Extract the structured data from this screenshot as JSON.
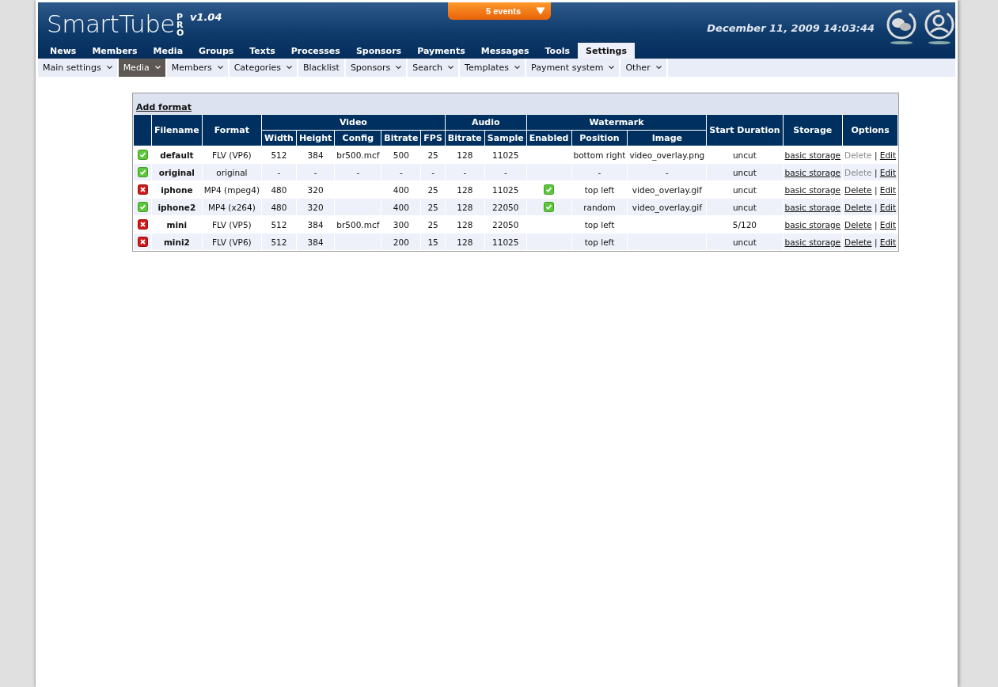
{
  "header": {
    "logo": "SmartTube",
    "logo_badge": "PRO",
    "version": "v1.04",
    "events": "5 events",
    "datetime": "December 11, 2009 14:03:44"
  },
  "nav": [
    {
      "label": "News",
      "selected": false
    },
    {
      "label": "Members",
      "selected": false
    },
    {
      "label": "Media",
      "selected": false
    },
    {
      "label": "Groups",
      "selected": false
    },
    {
      "label": "Texts",
      "selected": false
    },
    {
      "label": "Processes",
      "selected": false
    },
    {
      "label": "Sponsors",
      "selected": false
    },
    {
      "label": "Payments",
      "selected": false
    },
    {
      "label": "Messages",
      "selected": false
    },
    {
      "label": "Tools",
      "selected": false
    },
    {
      "label": "Settings",
      "selected": true
    }
  ],
  "subnav": [
    {
      "label": "Main settings",
      "kind": "dropdown",
      "selected": false
    },
    {
      "label": "Media",
      "kind": "dropdown",
      "selected": true
    },
    {
      "label": "Members",
      "kind": "dropdown",
      "selected": false
    },
    {
      "label": "Categories",
      "kind": "dropdown",
      "selected": false
    },
    {
      "label": "Blacklist",
      "kind": "link",
      "selected": false
    },
    {
      "label": "Sponsors",
      "kind": "dropdown",
      "selected": false
    },
    {
      "label": "Search",
      "kind": "dropdown",
      "selected": false
    },
    {
      "label": "Templates",
      "kind": "dropdown",
      "selected": false
    },
    {
      "label": "Payment system",
      "kind": "dropdown",
      "selected": false
    },
    {
      "label": "Other",
      "kind": "dropdown",
      "selected": false
    }
  ],
  "table": {
    "action": "Add format",
    "groups": [
      {
        "label": "Video",
        "columns": [
          "Width",
          "Height",
          "Config",
          "Bitrate",
          "FPS"
        ]
      },
      {
        "label": "Audio",
        "columns": [
          "Bitrate",
          "Sample"
        ]
      },
      {
        "label": "Watermark",
        "columns": [
          "Enabled",
          "Position",
          "Image"
        ]
      }
    ],
    "columns_before": [
      "Filename",
      "Format"
    ],
    "columns_after": [
      "Start Duration",
      "Storage",
      "Options"
    ],
    "rows": [
      {
        "active": true,
        "filename": "default",
        "format": "FLV (VP6)",
        "cells": [
          "512",
          "384",
          "br500.mcf",
          "500",
          "25",
          "128",
          "11025"
        ],
        "watermark_enabled": false,
        "position": "bottom right",
        "image": "video_overlay.png",
        "start_duration": "uncut",
        "storage": "basic storage",
        "delete": "Delete",
        "delete_disabled": true,
        "separator": "|",
        "edit": "Edit"
      },
      {
        "active": true,
        "filename": "original",
        "format": "original",
        "cells": [
          "-",
          "-",
          "-",
          "-",
          "-",
          "-",
          "-"
        ],
        "watermark_enabled": false,
        "position": "-",
        "image": "-",
        "start_duration": "uncut",
        "storage": "basic storage",
        "delete": "Delete",
        "delete_disabled": true,
        "separator": "|",
        "edit": "Edit"
      },
      {
        "active": false,
        "filename": "iphone",
        "format": "MP4 (mpeg4)",
        "cells": [
          "480",
          "320",
          "",
          "400",
          "25",
          "128",
          "11025"
        ],
        "watermark_enabled": true,
        "position": "top left",
        "image": "video_overlay.gif",
        "start_duration": "uncut",
        "storage": "basic storage",
        "delete": "Delete",
        "delete_disabled": false,
        "separator": "|",
        "edit": "Edit"
      },
      {
        "active": true,
        "filename": "iphone2",
        "format": "MP4 (x264)",
        "cells": [
          "480",
          "320",
          "",
          "400",
          "25",
          "128",
          "22050"
        ],
        "watermark_enabled": true,
        "position": "random",
        "image": "video_overlay.gif",
        "start_duration": "uncut",
        "storage": "basic storage",
        "delete": "Delete",
        "delete_disabled": false,
        "separator": "|",
        "edit": "Edit"
      },
      {
        "active": false,
        "filename": "mini",
        "format": "FLV (VP5)",
        "cells": [
          "512",
          "384",
          "br500.mcf",
          "300",
          "25",
          "128",
          "22050"
        ],
        "watermark_enabled": false,
        "position": "top left",
        "image": "",
        "start_duration": "5/120",
        "storage": "basic storage",
        "delete": "Delete",
        "delete_disabled": false,
        "separator": "|",
        "edit": "Edit"
      },
      {
        "active": false,
        "filename": "mini2",
        "format": "FLV (VP6)",
        "cells": [
          "512",
          "384",
          "",
          "200",
          "15",
          "128",
          "11025"
        ],
        "watermark_enabled": false,
        "position": "top left",
        "image": "",
        "start_duration": "uncut",
        "storage": "basic storage",
        "delete": "Delete",
        "delete_disabled": false,
        "separator": "|",
        "edit": "Edit"
      }
    ]
  }
}
